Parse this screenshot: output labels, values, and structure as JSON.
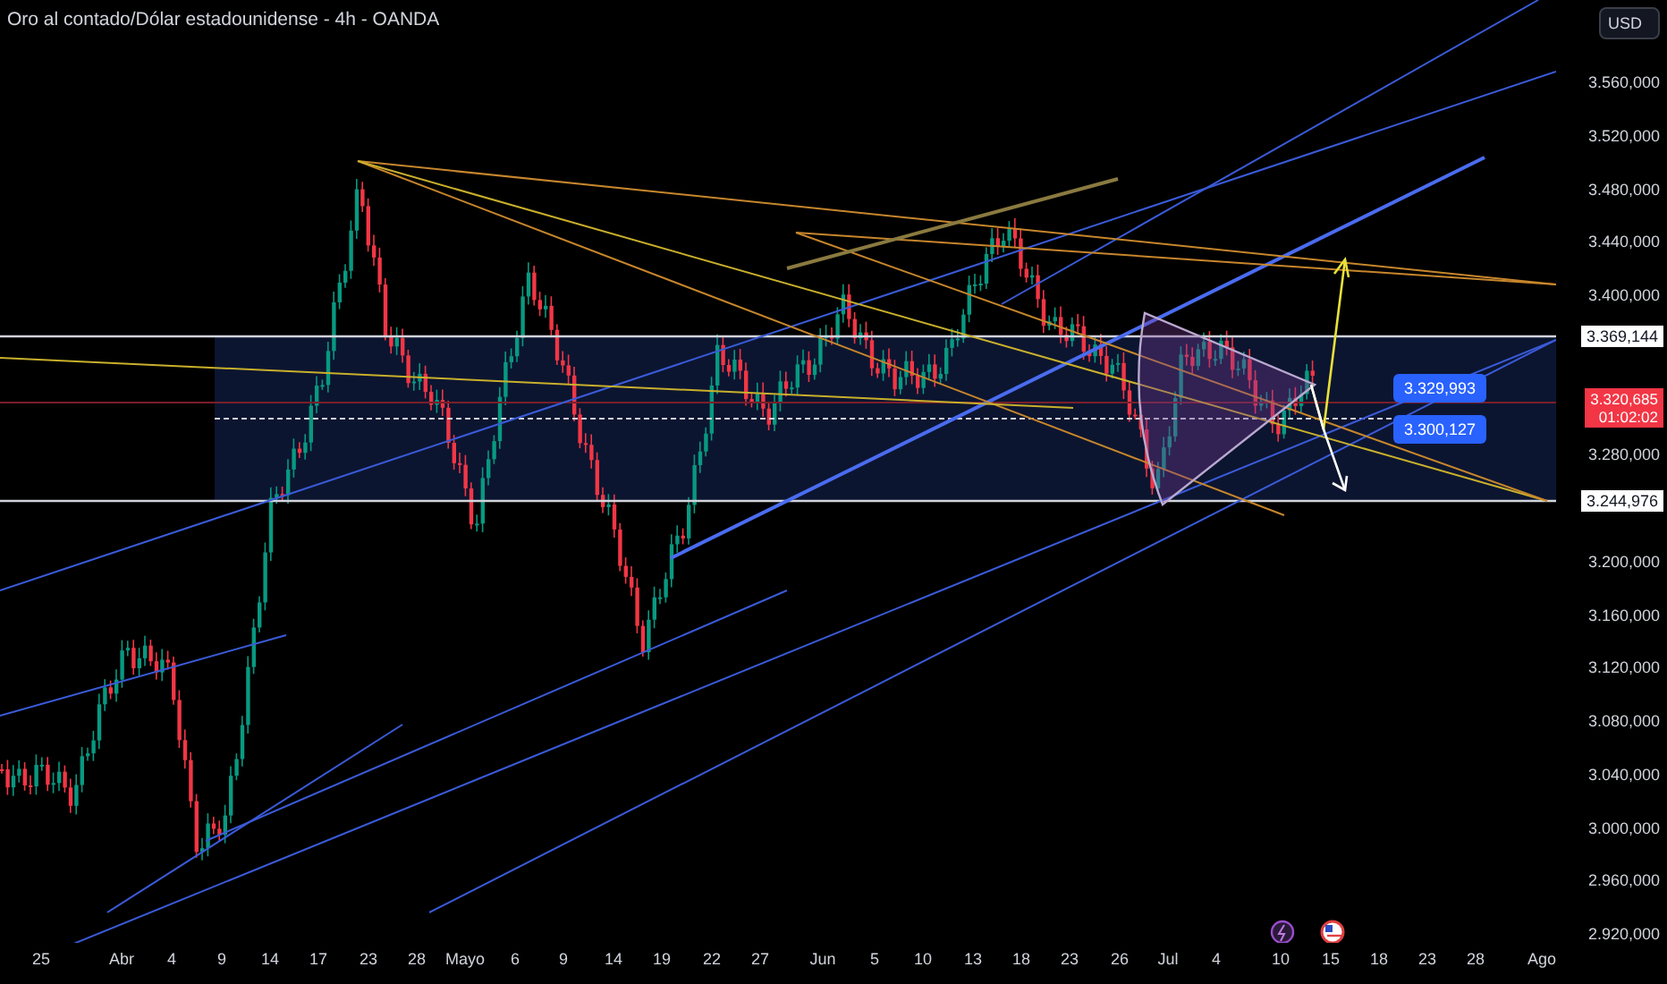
{
  "title": "Oro al contado/Dólar estadounidense - 4h - OANDA",
  "currency_button": "USD",
  "price_axis": [
    "3.560,000",
    "3.520,000",
    "3.480,000",
    "3.440,000",
    "3.400,000",
    "3.280,000",
    "3.200,000",
    "3.160,000",
    "3.120,000",
    "3.080,000",
    "3.040,000",
    "3.000,000",
    "2.960,000",
    "2.920,000"
  ],
  "price_markers": [
    {
      "kind": "level",
      "text": "3.369,144"
    },
    {
      "kind": "target",
      "text": "3.329,993"
    },
    {
      "kind": "current",
      "text": "3.320,685",
      "countdown": "01:02:02"
    },
    {
      "kind": "target",
      "text": "3.300,127"
    },
    {
      "kind": "level",
      "text": "3.244,976"
    }
  ],
  "time_axis": [
    "25",
    "Abr",
    "4",
    "9",
    "14",
    "17",
    "23",
    "28",
    "Mayo",
    "6",
    "9",
    "14",
    "19",
    "22",
    "27",
    "Jun",
    "5",
    "10",
    "13",
    "18",
    "23",
    "26",
    "Jul",
    "4",
    "10",
    "15",
    "18",
    "23",
    "28",
    "Ago"
  ]
}
